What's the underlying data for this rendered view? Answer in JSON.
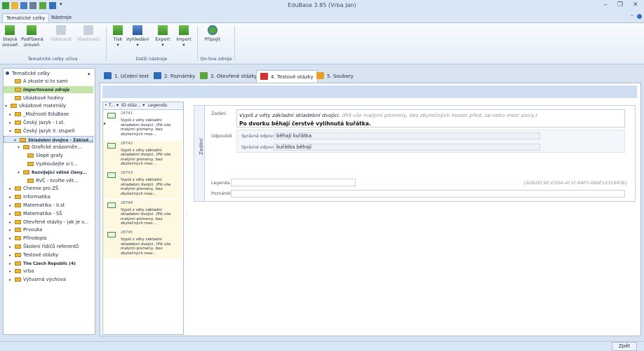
{
  "window": {
    "title": "EduBase 3.85 (Vrba Jan)",
    "colors": {
      "accent": "#2b5797",
      "selected_tree": "#c5e4a8",
      "active_tab_icon": "#d03030"
    }
  },
  "ribbon": {
    "tabs": [
      {
        "label": "Tematické celky"
      },
      {
        "label": "Nástroje"
      }
    ],
    "groups": [
      {
        "label": "Tematické celky učiva",
        "buttons": [
          {
            "label": "Stejná\núroveň",
            "icon": "add-sibling-icon",
            "enabled": true
          },
          {
            "label": "Podřízená\núroveň",
            "icon": "add-child-icon",
            "enabled": true
          },
          {
            "label": "Odstranit",
            "icon": "delete-icon",
            "enabled": false
          },
          {
            "label": "Vlastnosti",
            "icon": "properties-icon",
            "enabled": false
          }
        ]
      },
      {
        "label": "Další nástroje",
        "buttons": [
          {
            "label": "Tisk",
            "icon": "print-icon",
            "enabled": true
          },
          {
            "label": "Vyhledání",
            "icon": "search-icon",
            "enabled": true
          },
          {
            "label": "Export",
            "icon": "export-icon",
            "enabled": true
          },
          {
            "label": "Import",
            "icon": "import-icon",
            "enabled": true
          }
        ]
      },
      {
        "label": "On-line zdroje",
        "buttons": [
          {
            "label": "Připojit",
            "icon": "globe-icon",
            "enabled": true
          }
        ]
      }
    ]
  },
  "tree": {
    "root": "Tematické celky",
    "items": [
      {
        "label": "A zkuste si to sami",
        "exp": "",
        "style": ""
      },
      {
        "label": "Importované zdroje",
        "exp": "",
        "style": "sel"
      },
      {
        "label": "Ukázkové hodiny",
        "exp": "",
        "style": ""
      },
      {
        "label": "Ukázkové materiály",
        "exp": "▾",
        "style": ""
      },
      {
        "label": "_Možnosti EduBase",
        "exp": "▸",
        "style": ""
      },
      {
        "label": "Český jazyk - I.st.",
        "exp": "▸",
        "style": ""
      },
      {
        "label": "Český jazyk II. stupeň",
        "exp": "▾",
        "style": ""
      },
      {
        "label": "Skladební dvojice - Základ...",
        "exp": "▾",
        "style": "sel2"
      },
      {
        "label": "Grafické znázorněn...",
        "exp": "▾",
        "style": ""
      },
      {
        "label": "Slepé grafy",
        "exp": "",
        "style": ""
      },
      {
        "label": "Vyzkoušejte si t...",
        "exp": "",
        "style": ""
      },
      {
        "label": "Rozvíjející větné členy...",
        "exp": "▾",
        "style": ""
      },
      {
        "label": "RVČ - tvořte vět...",
        "exp": "",
        "style": ""
      },
      {
        "label": "Chemie pro ZŠ",
        "exp": "▸",
        "style": ""
      },
      {
        "label": "Informatika",
        "exp": "▸",
        "style": ""
      },
      {
        "label": "Matematika - II.st",
        "exp": "▸",
        "style": ""
      },
      {
        "label": "Matematika - SŠ",
        "exp": "▸",
        "style": ""
      },
      {
        "label": "Otevřené otázky - jak je v...",
        "exp": "▸",
        "style": ""
      },
      {
        "label": "Prvouka",
        "exp": "▸",
        "style": ""
      },
      {
        "label": "Přírodopis",
        "exp": "▸",
        "style": ""
      },
      {
        "label": "Školení řidičů referentů",
        "exp": "▸",
        "style": ""
      },
      {
        "label": "Testové otázky",
        "exp": "▸",
        "style": ""
      },
      {
        "label": "The Czech Republic (4)",
        "exp": "▸",
        "style": ""
      },
      {
        "label": "vrba",
        "exp": "▸",
        "style": ""
      },
      {
        "label": "Výtvarná výchova",
        "exp": "▸",
        "style": ""
      }
    ]
  },
  "content_tabs": [
    {
      "label": "1. Učební text",
      "color": "#2b6cb8"
    },
    {
      "label": "2. Poznámky",
      "color": "#2b6cb8"
    },
    {
      "label": "3. Otevřené otázky",
      "color": "#5aa53c"
    },
    {
      "label": "4. Testové otázky",
      "color": "#d03030"
    },
    {
      "label": "5. Soubory",
      "color": "#e8a020"
    }
  ],
  "question_list": {
    "columns": [
      "T...",
      "ID otáz...",
      "Legenda"
    ],
    "items": [
      {
        "id": "28741",
        "text": "Vypiš z věty základní skladební dvojici. (Piš vše malými písmeny, bez zbytečných mez..."
      },
      {
        "id": "28742",
        "text": "Vypiš z věty základní skladební dvojici. (Piš vše malými písmeny, bez zbytečných mez..."
      },
      {
        "id": "28743",
        "text": "Vypiš z věty základní skladební dvojici. (Piš vše malými písmeny, bez zbytečných mez..."
      },
      {
        "id": "28744",
        "text": "Vypiš z věty základní skladební dvojici. (Piš vše malými písmeny, bez zbytečných mez..."
      },
      {
        "id": "28745",
        "text": "Vypiš z věty základní skladební dvojici. (Piš vše malými písmeny, bez zbytečných mez..."
      }
    ]
  },
  "detail": {
    "side_label": "Zadání",
    "task_label": "Zadání",
    "task_italic": "Vypiš z věty základní skladební dvojici.",
    "task_gray": "(Piš vše malými písmeny, bez zbytečných mezer před, za nebo mezi slovy.)",
    "task_sentence": "Po dvorku běhají čerstvě vylíhnutá kuřátka.",
    "answers_label": "Odpovědi",
    "answers": [
      {
        "label": "Správná odpověď",
        "value": "běhají kuřátka"
      },
      {
        "label": "Správná odpověď",
        "value": "kuřátka běhají"
      }
    ],
    "legend_label": "Legenda",
    "legend_value": "",
    "guid": "{82B2EC9E-E5DA-4C1F-8AF5-086E1231845B}",
    "note_label": "Poznámka",
    "note_value": ""
  },
  "statusbar": {
    "back_label": "Zpět"
  }
}
